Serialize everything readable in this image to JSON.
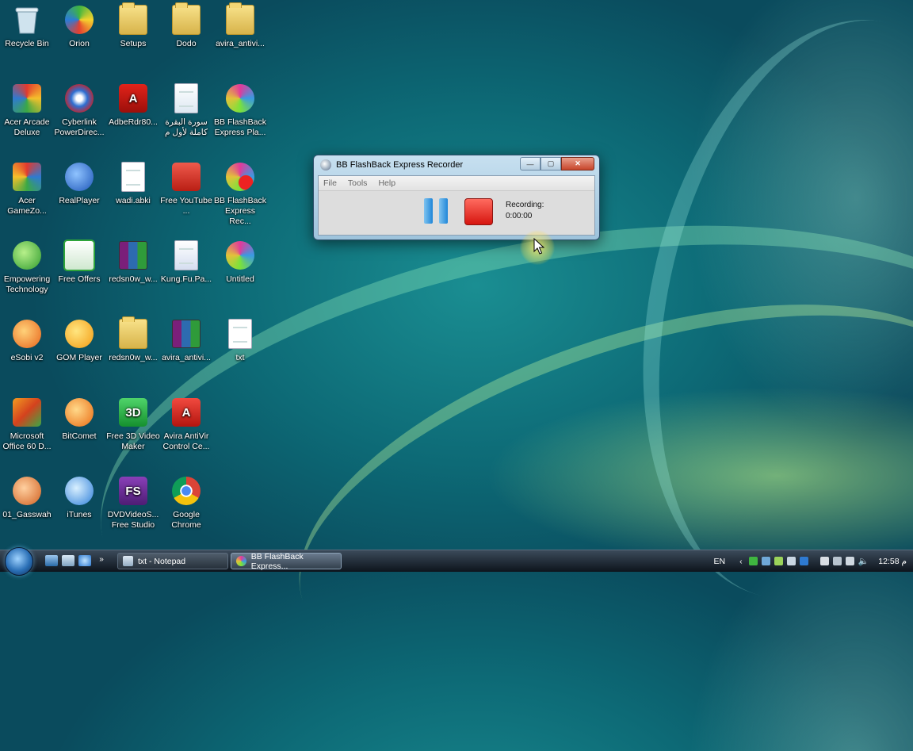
{
  "desktop": {
    "icons": [
      {
        "label": "Recycle Bin",
        "icon": "recycle-bin-icon"
      },
      {
        "label": "Orion",
        "icon": "orion-icon"
      },
      {
        "label": "Setups",
        "icon": "folder-icon"
      },
      {
        "label": "Dodo",
        "icon": "folder-icon"
      },
      {
        "label": "avira_antivi...",
        "icon": "folder-icon"
      },
      {
        "label": "Acer Arcade Deluxe",
        "icon": "acer-arcade-icon"
      },
      {
        "label": "Cyberlink PowerDirec...",
        "icon": "cyberlink-icon"
      },
      {
        "label": "AdbeRdr80...",
        "icon": "adobe-reader-icon"
      },
      {
        "label": "سورة البقرة كاملة لأول م",
        "icon": "audio-file-icon"
      },
      {
        "label": "BB FlashBack Express Pla...",
        "icon": "bb-flashback-player-icon"
      },
      {
        "label": "Acer GameZo...",
        "icon": "acer-gamezone-icon"
      },
      {
        "label": "RealPlayer",
        "icon": "realplayer-icon"
      },
      {
        "label": "wadi.abki",
        "icon": "mp3-file-icon"
      },
      {
        "label": "Free YouTube ...",
        "icon": "youtube-downloader-icon"
      },
      {
        "label": "BB FlashBack Express Rec...",
        "icon": "bb-flashback-recorder-icon"
      },
      {
        "label": "Empowering Technology",
        "icon": "empowering-tech-icon"
      },
      {
        "label": "Free Offers",
        "icon": "free-offers-icon"
      },
      {
        "label": "redsn0w_w...",
        "icon": "winrar-archive-icon"
      },
      {
        "label": "Kung.Fu.Pa...",
        "icon": "avi-file-icon"
      },
      {
        "label": "Untitled",
        "icon": "bb-flashback-movie-icon"
      },
      {
        "label": "eSobi v2",
        "icon": "esobi-icon"
      },
      {
        "label": "GOM Player",
        "icon": "gom-player-icon"
      },
      {
        "label": "redsn0w_w...",
        "icon": "folder-icon"
      },
      {
        "label": "avira_antivi...",
        "icon": "winrar-archive-icon"
      },
      {
        "label": "txt",
        "icon": "text-file-icon"
      },
      {
        "label": "Microsoft Office 60 D...",
        "icon": "office-icon"
      },
      {
        "label": "BitComet",
        "icon": "bitcomet-icon"
      },
      {
        "label": "Free 3D Video Maker",
        "icon": "3d-video-maker-icon"
      },
      {
        "label": "Avira AntiVir Control Ce...",
        "icon": "avira-icon"
      },
      {
        "label": "01_Gasswah",
        "icon": "realmedia-file-icon"
      },
      {
        "label": "iTunes",
        "icon": "itunes-icon"
      },
      {
        "label": "DVDVideoS... Free Studio",
        "icon": "dvdvideosoft-icon"
      },
      {
        "label": "Google Chrome",
        "icon": "chrome-icon"
      }
    ]
  },
  "recorder": {
    "title": "BB FlashBack Express Recorder",
    "menu": [
      "File",
      "Tools",
      "Help"
    ],
    "status_label": "Recording:",
    "time": "0:00:00",
    "controls": {
      "minimize": "—",
      "maximize": "▢",
      "close": "✕"
    }
  },
  "taskbar": {
    "tasks": [
      {
        "label": "txt - Notepad",
        "icon": "notepad-icon"
      },
      {
        "label": "BB FlashBack Express...",
        "icon": "bb-flashback-recorder-icon"
      }
    ],
    "language": "EN",
    "clock": "12:58 م"
  },
  "colors": {
    "desktop_bg": "#0d6a76",
    "stop": "#d6150f",
    "pause": "#1f86d8",
    "taskbar": "#0d141c"
  }
}
